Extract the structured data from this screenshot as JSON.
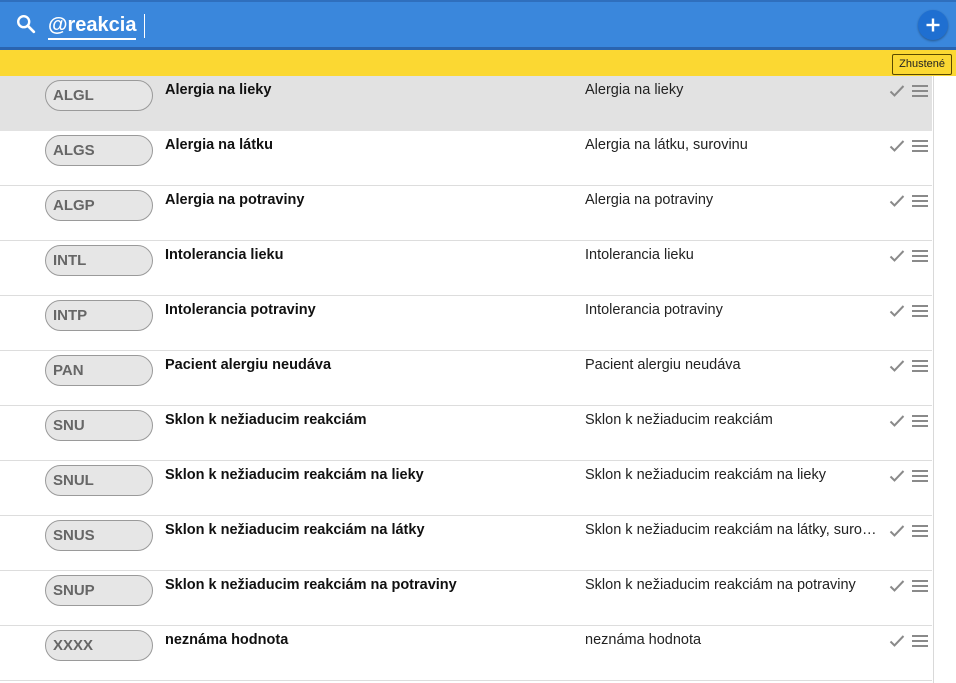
{
  "header": {
    "search_query": "@reakcia",
    "search_icon": "search-icon",
    "add_icon": "plus-icon",
    "colors": {
      "bar": "#3a87dc",
      "accent": "#1f6fd1",
      "toolbar": "#fbd832"
    }
  },
  "toolbar": {
    "compact_label": "Zhustené"
  },
  "rows": [
    {
      "code": "ALGL",
      "title": "Alergia na lieky",
      "description": "Alergia na lieky",
      "selected": true
    },
    {
      "code": "ALGS",
      "title": "Alergia na látku",
      "description": "Alergia na látku, surovinu"
    },
    {
      "code": "ALGP",
      "title": "Alergia na potraviny",
      "description": "Alergia na potraviny"
    },
    {
      "code": "INTL",
      "title": "Intolerancia lieku",
      "description": "Intolerancia lieku"
    },
    {
      "code": "INTP",
      "title": "Intolerancia potraviny",
      "description": "Intolerancia potraviny"
    },
    {
      "code": "PAN",
      "title": "Pacient alergiu neudáva",
      "description": "Pacient alergiu neudáva"
    },
    {
      "code": "SNU",
      "title": "Sklon k nežiaducim reakciám",
      "description": "Sklon k nežiaducim reakciám"
    },
    {
      "code": "SNUL",
      "title": "Sklon k nežiaducim reakciám na lieky",
      "description": "Sklon k nežiaducim reakciám na lieky"
    },
    {
      "code": "SNUS",
      "title": "Sklon k nežiaducim reakciám na látky",
      "description": "Sklon k nežiaducim reakciám na látky, suroviny"
    },
    {
      "code": "SNUP",
      "title": "Sklon k nežiaducim reakciám na potraviny",
      "description": "Sklon k nežiaducim reakciám na potraviny"
    },
    {
      "code": "XXXX",
      "title": "neznáma hodnota",
      "description": "neznáma hodnota"
    }
  ],
  "row_icons": {
    "confirm": "check-icon",
    "menu": "menu-icon"
  }
}
